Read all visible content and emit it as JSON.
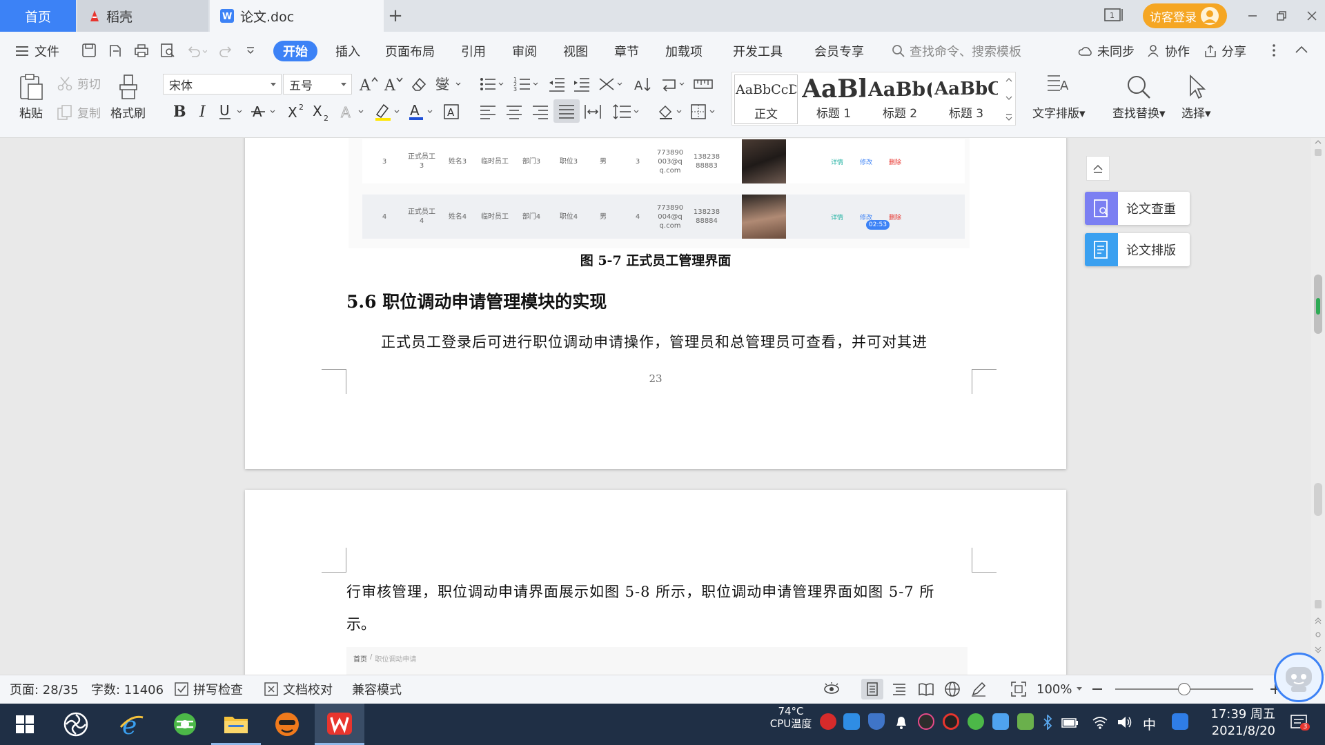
{
  "tabs": {
    "home": "首页",
    "daoke": "稻壳",
    "doc": "论文.doc",
    "add": "+"
  },
  "window": {
    "guest_login": "访客登录"
  },
  "menu": {
    "file": "文件",
    "items": [
      "开始",
      "插入",
      "页面布局",
      "引用",
      "审阅",
      "视图",
      "章节",
      "加载项",
      "开发工具",
      "会员专享"
    ],
    "search_placeholder": "查找命令、搜索模板",
    "unsynced": "未同步",
    "collab": "协作",
    "share": "分享"
  },
  "ribbon": {
    "paste": "粘贴",
    "cut": "剪切",
    "copy": "复制",
    "format_painter": "格式刷",
    "font_name": "宋体",
    "font_size": "五号",
    "styles": [
      {
        "sample": "AaBbCcDd",
        "label": "正文"
      },
      {
        "sample": "AaBl",
        "label": "标题 1"
      },
      {
        "sample": "AaBb(",
        "label": "标题 2"
      },
      {
        "sample": "AaBbC",
        "label": "标题 3"
      }
    ],
    "text_layout": "文字排版",
    "find_replace": "查找替换",
    "select": "选择"
  },
  "document": {
    "table_rows": [
      {
        "no": "3",
        "type": "正式员工3",
        "name": "姓名3",
        "kind": "临时员工",
        "dept": "部门3",
        "post": "职位3",
        "gender": "男",
        "num": "3",
        "email": "773890003@qq.com",
        "phone": "13823888883",
        "actions": [
          "详情",
          "修改",
          "删除"
        ]
      },
      {
        "no": "4",
        "type": "正式员工4",
        "name": "姓名4",
        "kind": "临时员工",
        "dept": "部门4",
        "post": "职位4",
        "gender": "男",
        "num": "4",
        "email": "773890004@qq.com",
        "phone": "13823888884",
        "actions": [
          "详情",
          "修改",
          "删除"
        ]
      }
    ],
    "time_badge": "02:53",
    "figure_caption": "图 5-7    正式员工管理界面",
    "section_heading": "5.6  职位调动申请管理模块的实现",
    "para1": "正式员工登录后可进行职位调动申请操作，管理员和总管理员可查看，并可对其进",
    "page_number": "23",
    "para2_line1": "行审核管理，职位调动申请界面展示如图 5-8 所示，职位调动申请管理界面如图 5-7 所",
    "para2_line2": "示。",
    "breadcrumb_home": "首页",
    "breadcrumb_sep": "/",
    "breadcrumb_page": "职位调动申请"
  },
  "side_panel": {
    "check": "论文查重",
    "layout": "论文排版"
  },
  "statusbar": {
    "page": "页面: 28/35",
    "words": "字数: 11406",
    "spell": "拼写检查",
    "proofread": "文档校对",
    "compat": "兼容模式",
    "zoom": "100%",
    "zoom_level": 0.5
  },
  "taskbar": {
    "temp": "74°C",
    "cpu": "CPU温度",
    "time": "17:39 周五",
    "date": "2021/8/20",
    "lang": "中",
    "notif_count": "3"
  },
  "colors": {
    "accent": "#3c82f6",
    "guest": "#f5a623",
    "taskbar": "#1f2f45",
    "wps_red": "#e8352e"
  }
}
